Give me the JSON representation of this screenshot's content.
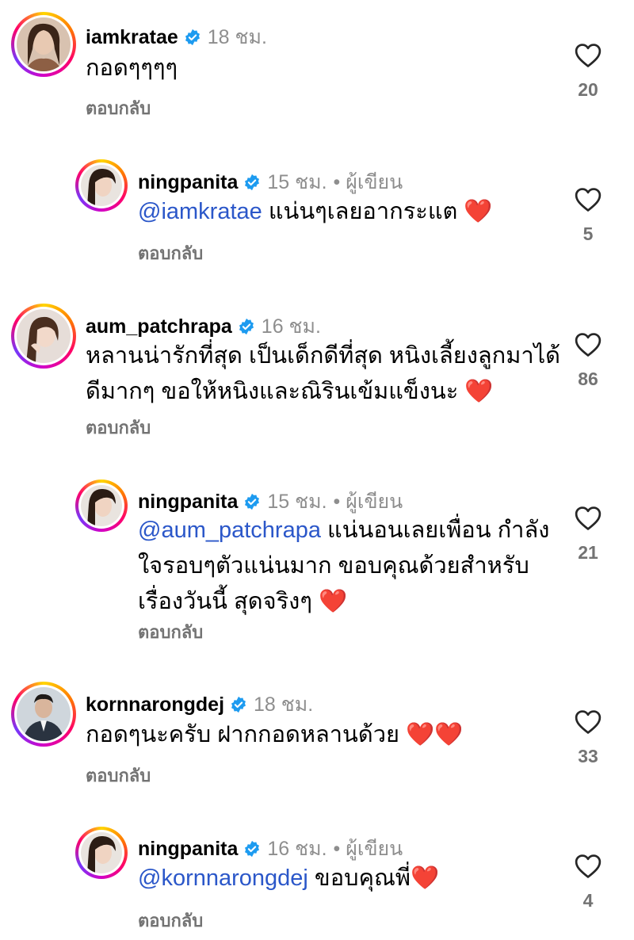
{
  "comments": [
    {
      "username": "iamkratae",
      "time": "18 ชม.",
      "author_tag": "",
      "text_parts": [
        "กอดๆๆๆๆ"
      ],
      "mention": "",
      "reply_label": "ตอบกลับ",
      "likes": "20"
    },
    {
      "username": "ningpanita",
      "time": "15 ชม.",
      "author_tag": "• ผู้เขียน",
      "mention": "@iamkratae",
      "text_parts": [
        " แน่นๆเลยอากระแต ❤️"
      ],
      "reply_label": "ตอบกลับ",
      "likes": "5"
    },
    {
      "username": "aum_patchrapa",
      "time": "16 ชม.",
      "author_tag": "",
      "mention": "",
      "text_parts": [
        "หลานน่ารักที่สุด เป็นเด็กดีที่สุด หนิงเลี้ยงลูกมาได้",
        "ดีมากๆ ขอให้หนิงและณิรินเข้มแข็งนะ ❤️"
      ],
      "reply_label": "ตอบกลับ",
      "likes": "86"
    },
    {
      "username": "ningpanita",
      "time": "15 ชม.",
      "author_tag": "• ผู้เขียน",
      "mention": "@aum_patchrapa",
      "text_parts": [
        " แน่นอนเลยเพื่อน กำลัง",
        "ใจรอบๆตัวแน่นมาก ขอบคุณด้วยสำหรับ",
        "เรื่องวันนี้ สุดจริงๆ ❤️"
      ],
      "reply_label": "ตอบกลับ",
      "likes": "21"
    },
    {
      "username": "kornnarongdej",
      "time": "18 ชม.",
      "author_tag": "",
      "mention": "",
      "text_parts": [
        "กอดๆนะครับ ฝากกอดหลานด้วย ❤️❤️"
      ],
      "reply_label": "ตอบกลับ",
      "likes": "33"
    },
    {
      "username": "ningpanita",
      "time": "16 ชม.",
      "author_tag": "• ผู้เขียน",
      "mention": "@kornnarongdej",
      "text_parts": [
        " ขอบคุณพี่❤️"
      ],
      "reply_label": "ตอบกลับ",
      "likes": "4"
    }
  ],
  "colors": {
    "mention": "#2b57c9",
    "meta": "#8e8e8e",
    "verified": "#1d9bf0",
    "heart": "#e0242f"
  },
  "icons": {
    "like": "heart-outline-icon",
    "verified": "verified-badge-icon"
  }
}
